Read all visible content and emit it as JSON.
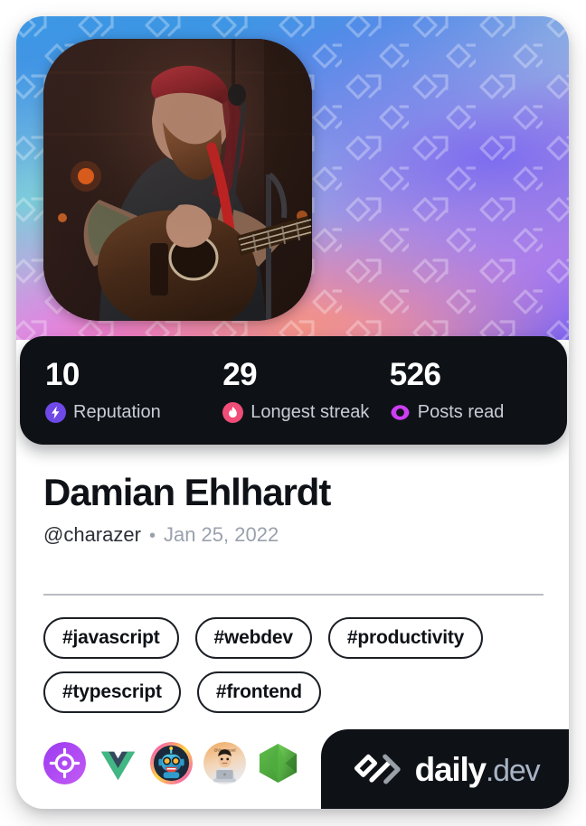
{
  "card": {
    "type": "devcard",
    "background": "#ffffff",
    "accent_cover_colors": [
      "#3f9ae4",
      "#5b8fe8",
      "#9fd0dd",
      "#d9a9d8",
      "#c98ae6",
      "#7b63ef"
    ],
    "watermark_icon": "daily-dev-chevron-watermark"
  },
  "avatar": {
    "alt": "profile photo of bearded man with red bandana playing acoustic guitar on a dark stage",
    "icon": "user-avatar"
  },
  "stats": {
    "panel_bg": "#0e1217",
    "items": [
      {
        "value": "10",
        "label": "Reputation",
        "icon": "lightning-bolt-icon",
        "color": "#6E49E8"
      },
      {
        "value": "29",
        "label": "Longest streak",
        "icon": "flame-icon",
        "color": "#F04D78"
      },
      {
        "value": "526",
        "label": "Posts read",
        "icon": "eye-ring-icon",
        "color": "#CE3DF3"
      }
    ]
  },
  "identity": {
    "display_name": "Damian Ehlhardt",
    "handle": "@charazer",
    "separator": "•",
    "joined_date": "Jan 25, 2022"
  },
  "tags": [
    "#javascript",
    "#webdev",
    "#productivity",
    "#typescript",
    "#frontend"
  ],
  "sources": [
    {
      "name": "target-crosshair-source",
      "alt": "purple circle with white crosshair target icon"
    },
    {
      "name": "vuejs-source",
      "alt": "Vue.js green and navy chevron logo"
    },
    {
      "name": "robot-source",
      "alt": "cartoon robot avatar with magenta and yellow ring"
    },
    {
      "name": "memoji-person-source",
      "alt": "memoji of person at a laptop on orange background"
    },
    {
      "name": "hexagon-source",
      "alt": "green hexagon logo"
    }
  ],
  "brand": {
    "mark": "daily-dev-logo-mark",
    "name": "daily",
    "tld": ".dev"
  }
}
